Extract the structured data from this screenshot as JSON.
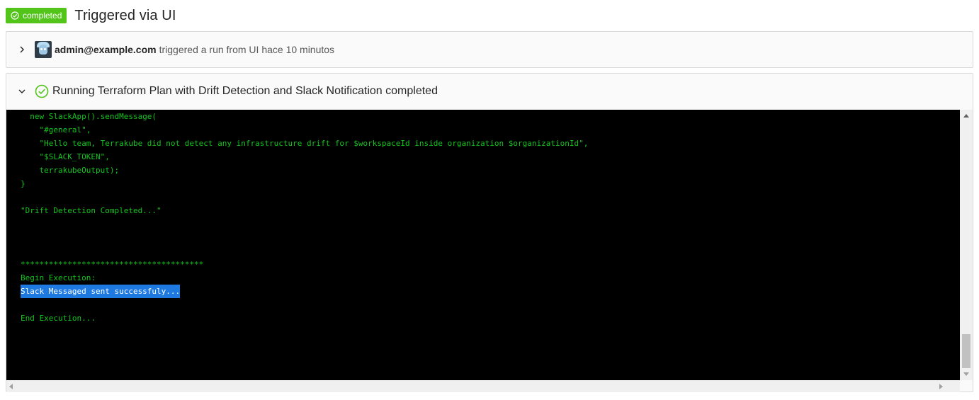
{
  "header": {
    "status_badge": "completed",
    "title": "Triggered via UI"
  },
  "trigger": {
    "user": "admin@example.com",
    "text": "triggered a run from UI hace 10 minutos"
  },
  "step": {
    "title": "Running Terraform Plan with Drift Detection and Slack Notification completed"
  },
  "console": {
    "lines": [
      "  new SlackApp().sendMessage(",
      "    \"#general\",",
      "    \"Hello team, Terrakube did not detect any infrastructure drift for $workspaceId inside organization $organizationId\",",
      "    \"$SLACK_TOKEN\",",
      "    terrakubeOutput);",
      "}",
      "",
      "\"Drift Detection Completed...\"",
      "",
      "",
      "",
      "***************************************",
      "Begin Execution:",
      "Slack Messaged sent successfuly...",
      "",
      "End Execution..."
    ],
    "highlighted_line": 13
  },
  "colors": {
    "success": "#52c41a",
    "console_text": "#13c41e",
    "console_bg": "#000000",
    "selection": "#1e7ae0"
  }
}
